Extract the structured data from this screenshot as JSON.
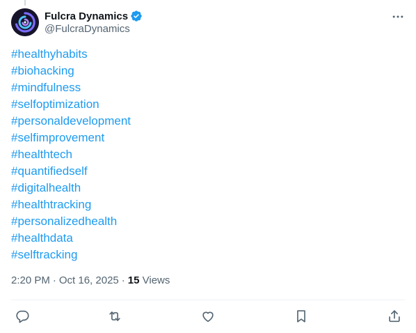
{
  "tweet": {
    "author": {
      "display_name": "Fulcra Dynamics",
      "handle": "@FulcraDynamics",
      "verified": true,
      "verified_color": "#1d9bf0"
    },
    "hashtags": [
      "#healthyhabits",
      "#biohacking",
      "#mindfulness",
      "#selfoptimization",
      "#personaldevelopment",
      "#selfimprovement",
      "#healthtech",
      "#quantifiedself",
      "#digitalhealth",
      "#healthtracking",
      "#personalizedhealth",
      "#healthdata",
      "#selftracking"
    ],
    "time": "2:20 PM",
    "date": "Oct 16, 2025",
    "separator": "·",
    "views_count": "15",
    "views_label": "Views",
    "link_color": "#1d9bf0"
  },
  "icons": {
    "more": "more-icon",
    "reply": "reply-icon",
    "repost": "repost-icon",
    "like": "heart-icon",
    "bookmark": "bookmark-icon",
    "share": "share-icon"
  }
}
